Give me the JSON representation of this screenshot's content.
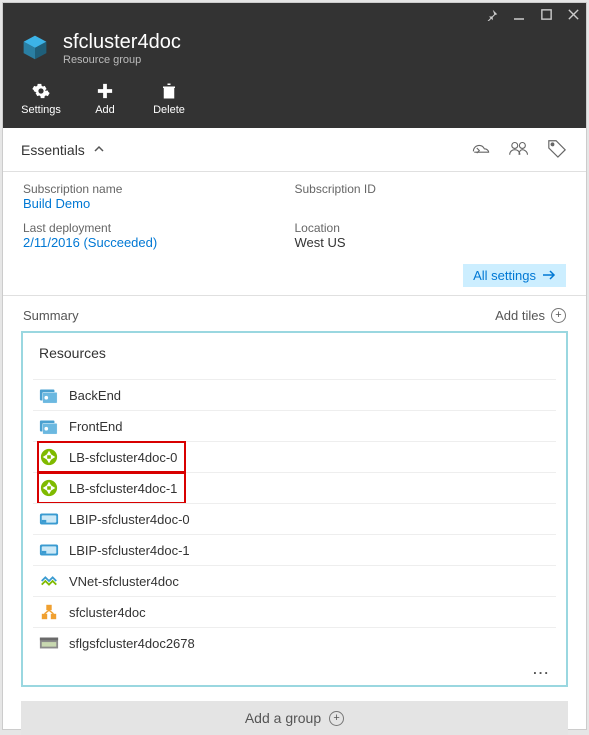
{
  "window": {
    "title": "sfcluster4doc",
    "subtitle": "Resource group"
  },
  "toolbar": {
    "settings": "Settings",
    "add": "Add",
    "delete": "Delete"
  },
  "essentials": {
    "heading": "Essentials",
    "subscription_name_label": "Subscription name",
    "subscription_name_value": "Build Demo",
    "last_deployment_label": "Last deployment",
    "last_deployment_value": "2/11/2016 (Succeeded)",
    "subscription_id_label": "Subscription ID",
    "location_label": "Location",
    "location_value": "West US",
    "all_settings": "All settings"
  },
  "summary": {
    "heading": "Summary",
    "add_tiles": "Add tiles",
    "resources_heading": "Resources",
    "more": "...",
    "add_group": "Add a group"
  },
  "resources": [
    {
      "name": "BackEnd",
      "icon": "cloudservice",
      "highlight": false
    },
    {
      "name": "FrontEnd",
      "icon": "cloudservice",
      "highlight": false
    },
    {
      "name": "LB-sfcluster4doc-0",
      "icon": "loadbalancer",
      "highlight": true
    },
    {
      "name": "LB-sfcluster4doc-1",
      "icon": "loadbalancer",
      "highlight": true
    },
    {
      "name": "LBIP-sfcluster4doc-0",
      "icon": "publicip",
      "highlight": false
    },
    {
      "name": "LBIP-sfcluster4doc-1",
      "icon": "publicip",
      "highlight": false
    },
    {
      "name": "VNet-sfcluster4doc",
      "icon": "vnet",
      "highlight": false
    },
    {
      "name": "sfcluster4doc",
      "icon": "sfcluster",
      "highlight": false
    },
    {
      "name": "sflgsfcluster4doc2678",
      "icon": "storage",
      "highlight": false
    }
  ]
}
